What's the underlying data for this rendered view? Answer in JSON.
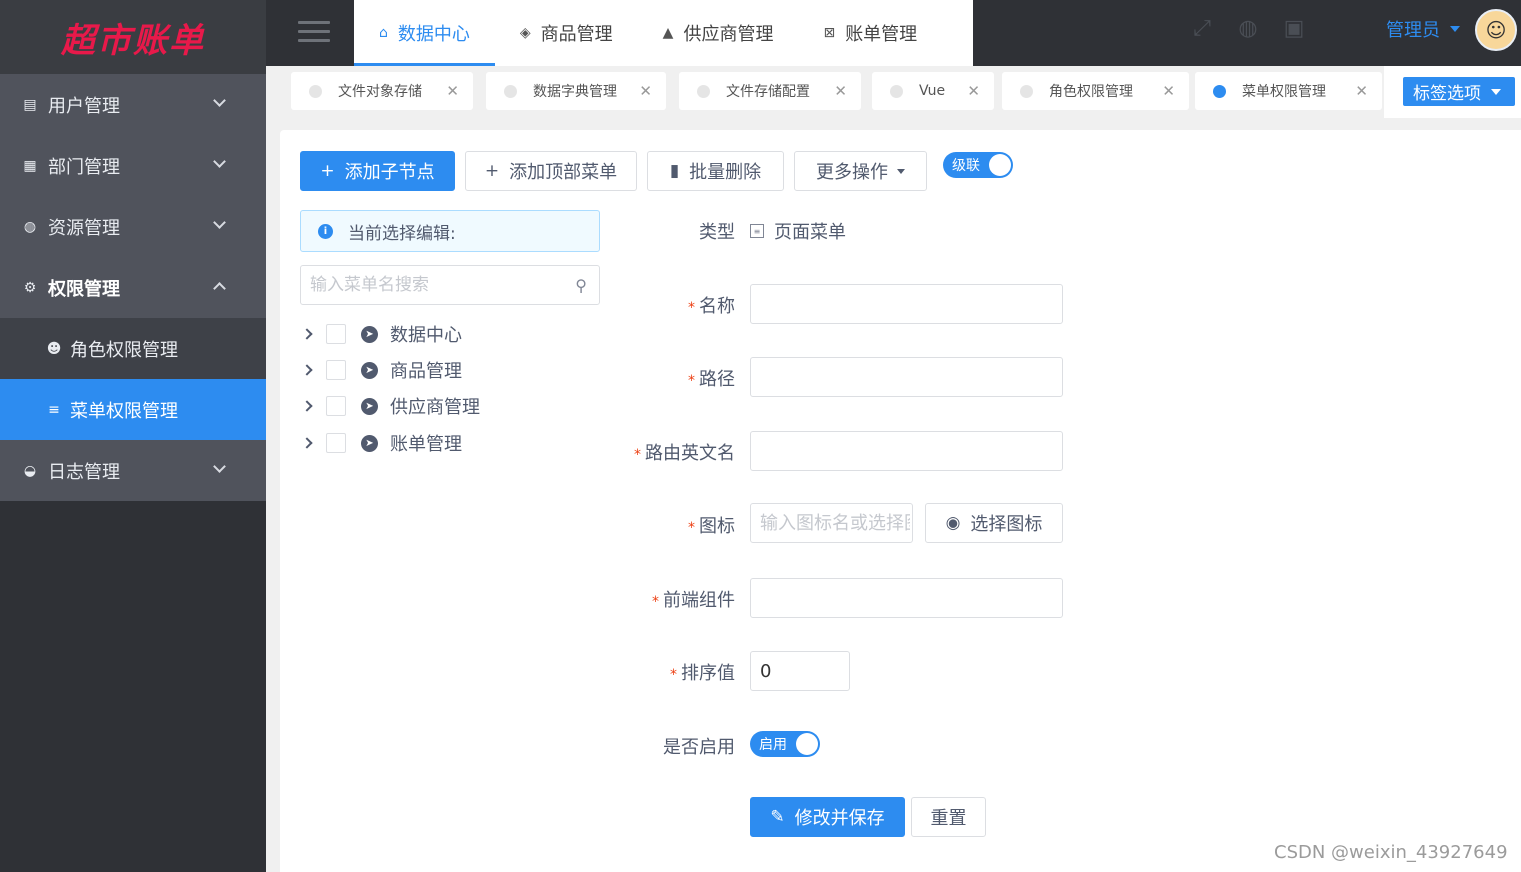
{
  "app": {
    "logo": "超市账单"
  },
  "sidebar": {
    "items": [
      {
        "label": "用户管理",
        "icon": "chart-icon"
      },
      {
        "label": "部门管理",
        "icon": "grid-icon"
      },
      {
        "label": "资源管理",
        "icon": "globe-icon"
      },
      {
        "label": "权限管理",
        "icon": "gear-icon"
      },
      {
        "label": "日志管理",
        "icon": "pie-icon"
      }
    ],
    "submenu": [
      {
        "label": "角色权限管理",
        "icon": "users-icon"
      },
      {
        "label": "菜单权限管理",
        "icon": "list-icon"
      }
    ]
  },
  "topnav": {
    "tabs": [
      {
        "label": "数据中心",
        "icon": "home-icon"
      },
      {
        "label": "商品管理",
        "icon": "tag-icon"
      },
      {
        "label": "供应商管理",
        "icon": "flask-icon"
      },
      {
        "label": "账单管理",
        "icon": "bill-icon"
      }
    ],
    "user": "管理员"
  },
  "tags": {
    "items": [
      "文件对象存储",
      "数据字典管理",
      "文件存储配置",
      "Vue",
      "角色权限管理",
      "菜单权限管理"
    ],
    "options_label": "标签选项"
  },
  "toolbar": {
    "add_child": "添加子节点",
    "add_top": "添加顶部菜单",
    "batch_delete": "批量删除",
    "more": "更多操作",
    "cascade": "级联"
  },
  "tree": {
    "alert": "当前选择编辑:",
    "search_placeholder": "输入菜单名搜索",
    "nodes": [
      "数据中心",
      "商品管理",
      "供应商管理",
      "账单管理"
    ]
  },
  "form": {
    "type_label": "类型",
    "type_value": "页面菜单",
    "name_label": "名称",
    "path_label": "路径",
    "route_label": "路由英文名",
    "icon_label": "图标",
    "icon_placeholder": "输入图标名或选择图标",
    "select_icon": "选择图标",
    "component_label": "前端组件",
    "sort_label": "排序值",
    "sort_value": "0",
    "enabled_label": "是否启用",
    "enabled_text": "启用",
    "save": "修改并保存",
    "reset": "重置"
  },
  "watermark": "CSDN @weixin_43927649"
}
